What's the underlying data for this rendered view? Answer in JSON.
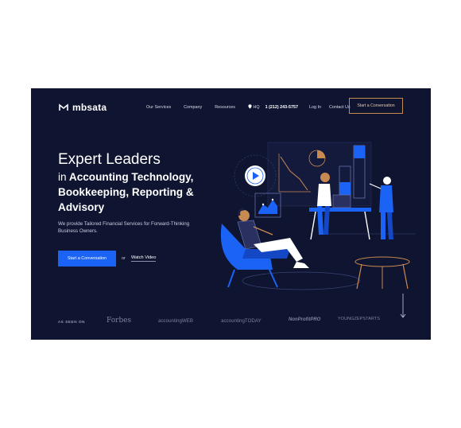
{
  "brand": {
    "name": "mbsata"
  },
  "nav": {
    "items": [
      "Our Services",
      "Company",
      "Resources"
    ],
    "hq_label": "HQ",
    "phone": "1 (212) 243-5757",
    "login": "Log In",
    "contact": "Contact Us",
    "cta": "Start a Conversation"
  },
  "hero": {
    "headline_light": "Expert Leaders",
    "headline_lead": "in",
    "headline_bold": "Accounting Technology, Bookkeeping, Reporting & Advisory",
    "subtext": "We provide Tailored Financial Services for Forward-Thinking Business Owners.",
    "primary_cta": "Start a Conversation",
    "or_text": "or",
    "secondary_cta": "Watch Video"
  },
  "press": {
    "label": "AS SEEN ON",
    "logos": [
      "Forbes",
      "accountingWEB",
      "accountingTODAY",
      "NonProfitPRO",
      "YOUNGZEPSTARTS"
    ]
  },
  "colors": {
    "background": "#0f1430",
    "accent_blue": "#1a63f5",
    "cta_border": "#c98a52"
  },
  "icons": [
    "logo-mark-icon",
    "location-pin-icon",
    "play-icon",
    "scroll-down-arrow-icon"
  ]
}
